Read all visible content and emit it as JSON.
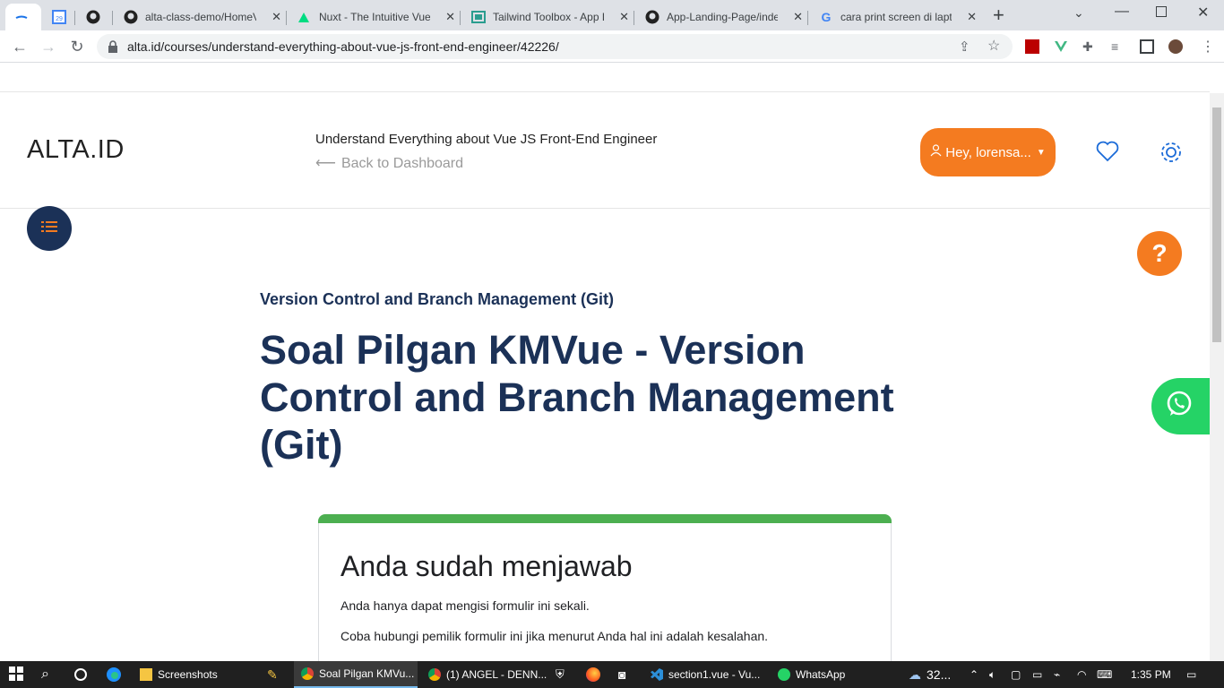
{
  "browser": {
    "tabs": [
      {
        "title": "",
        "active": true
      },
      {
        "title": "",
        "icon": "calendar-icon"
      },
      {
        "title": "",
        "icon": "github-icon"
      },
      {
        "title": "alta-class-demo/HomeV",
        "icon": "github-icon"
      },
      {
        "title": "Nuxt - The Intuitive Vue",
        "icon": "nuxt-icon"
      },
      {
        "title": "Tailwind Toolbox - App L",
        "icon": "tailwind-toolbox-icon"
      },
      {
        "title": "App-Landing-Page/inde",
        "icon": "github-icon"
      },
      {
        "title": "cara print screen di lapto",
        "icon": "google-icon"
      }
    ],
    "new_tab": "+",
    "url": "alta.id/courses/understand-everything-about-vue-js-front-end-engineer/42226/"
  },
  "header": {
    "logo": "ALTA.ID",
    "course_title": "Understand Everything about Vue JS Front-End Engineer",
    "back_label": "Back to Dashboard",
    "user_label": "Hey, lorensa...",
    "accent": "#f47b20",
    "navy": "#1b3157"
  },
  "main": {
    "subtitle": "Version Control and Branch Management (Git)",
    "heading": "Soal Pilgan KMVue - Version Control and Branch Management (Git)",
    "help_label": "?"
  },
  "form_card": {
    "title": "Anda sudah menjawab",
    "line1": "Anda hanya dapat mengisi formulir ini sekali.",
    "line2": "Coba hubungi pemilik formulir ini jika menurut Anda hal ini adalah kesalahan.",
    "accent": "#4caf50"
  },
  "taskbar": {
    "items": [
      {
        "label": "Screenshots"
      },
      {
        "label": "Soal Pilgan KMVu..."
      },
      {
        "label": "(1) ANGEL - DENN..."
      },
      {
        "label": "section1.vue - Vu..."
      },
      {
        "label": "WhatsApp"
      }
    ],
    "weather": "32...",
    "time": "1:35 PM"
  }
}
